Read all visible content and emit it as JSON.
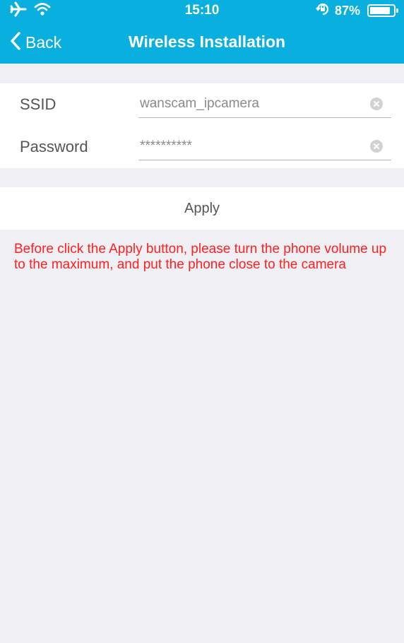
{
  "status_bar": {
    "time": "15:10",
    "battery_text": "87%",
    "battery_level": 0.87,
    "left_icons": [
      "airplane-icon",
      "wifi-icon"
    ],
    "right_icons": [
      "orientation-lock-icon",
      "battery-icon"
    ]
  },
  "nav": {
    "back_label": "Back",
    "title": "Wireless Installation"
  },
  "form": {
    "ssid_label": "SSID",
    "ssid_value": "wanscam_ipcamera",
    "password_label": "Password",
    "password_value": "**********"
  },
  "apply": {
    "label": "Apply"
  },
  "notice": {
    "text": "Before click the Apply button, please turn the phone volume up to the maximum, and put the phone close to the camera"
  },
  "colors": {
    "header": "#09b0df",
    "background": "#efeff4",
    "notice": "#ff2020"
  }
}
